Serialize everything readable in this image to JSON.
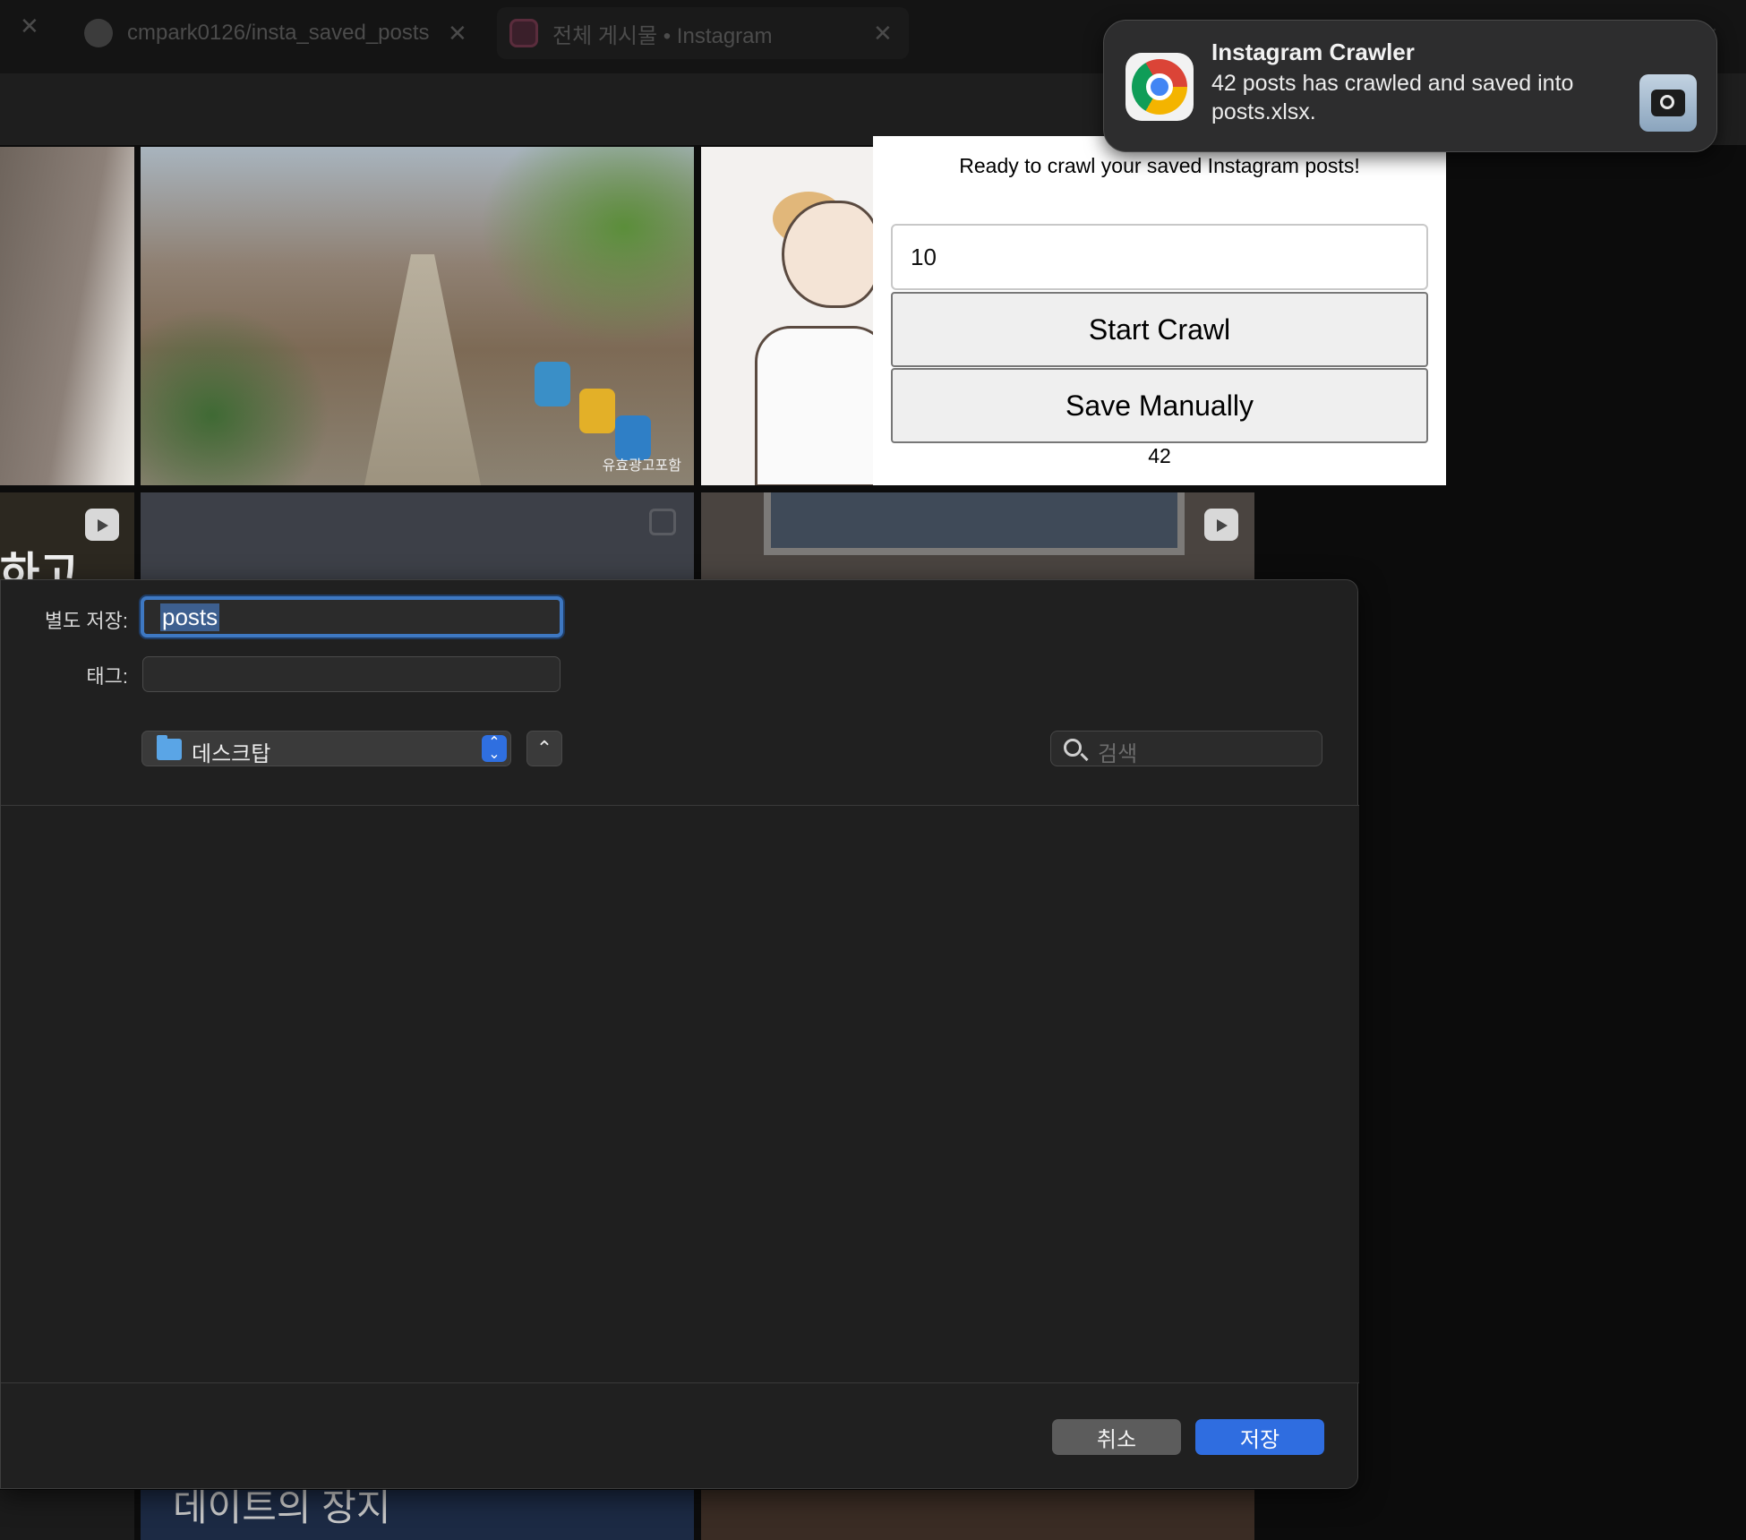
{
  "browser": {
    "tabs": [
      {
        "title": "cmpark0126/insta_saved_posts",
        "icon": "github-icon"
      },
      {
        "title": "전체 게시물 • Instagram",
        "icon": "instagram-icon"
      }
    ]
  },
  "grid": {
    "watermark": "유효광고포함",
    "reel_overlay_text": "하고",
    "bottom_overlay_text": "데이트의 장지"
  },
  "popup": {
    "message": "Ready to crawl your saved Instagram posts!",
    "count_value": "10",
    "start_button": "Start Crawl",
    "save_button": "Save Manually",
    "result_count": "42"
  },
  "notification": {
    "app_name": "Instagram Crawler",
    "body": "42 posts has crawled and saved into posts.xlsx.",
    "app_icon": "chrome-icon",
    "side_icon": "screenshot-icon"
  },
  "save_dialog": {
    "save_as_label": "별도 저장:",
    "save_as_value": "posts",
    "tags_label": "태그:",
    "tags_value": "",
    "location": "데스크탑",
    "search_placeholder": "검색",
    "cancel_button": "취소",
    "save_button": "저장"
  },
  "colors": {
    "accent": "#2f6de0",
    "focus_ring": "#3e78c2",
    "dialog_bg": "#202020"
  }
}
